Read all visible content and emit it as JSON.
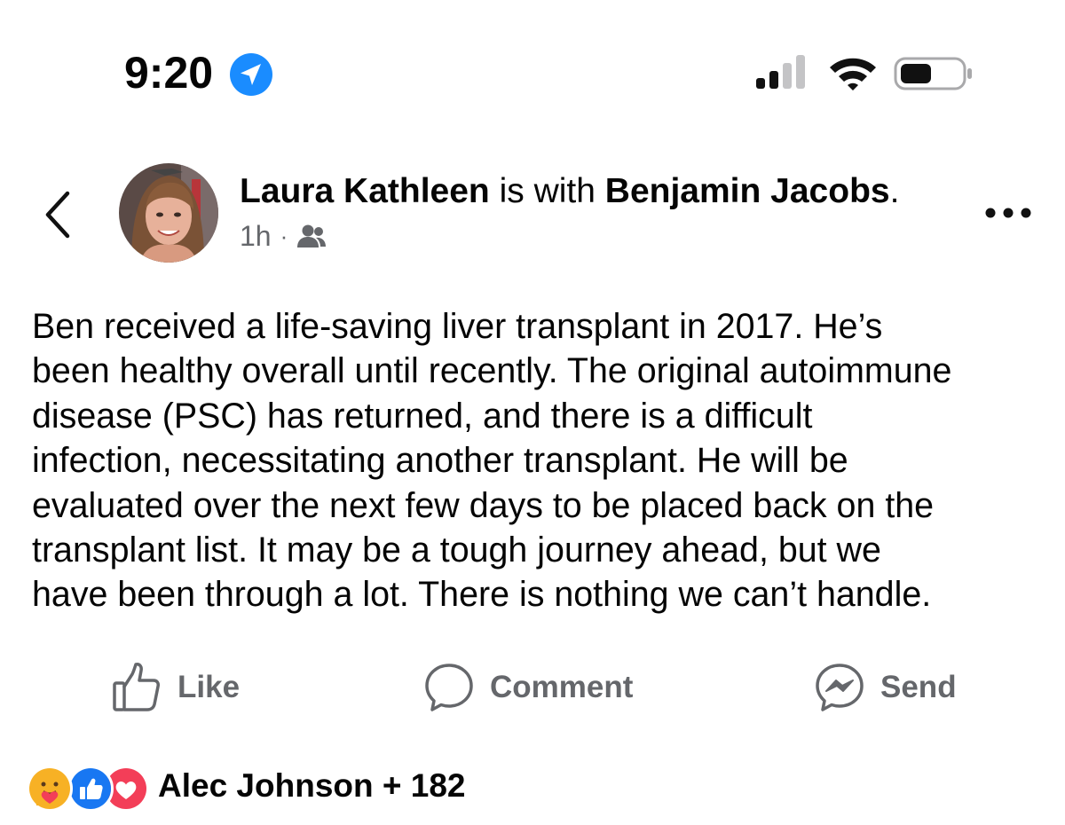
{
  "status_bar": {
    "time": "9:20",
    "icons": [
      "location-arrow-icon",
      "cellular-signal-icon",
      "wifi-icon",
      "battery-icon"
    ]
  },
  "post": {
    "author": "Laura Kathleen",
    "with_text": "is with",
    "tagged": "Benjamin Jacobs",
    "tagged_suffix": ".",
    "time_ago": "1h",
    "separator": "·",
    "audience_icon": "friends-icon",
    "body_lines": [
      "Ben received a life-saving liver transplant in 2017. He’s",
      "been healthy overall until recently. The original autoimmune",
      "disease (PSC) has returned, and there is a difficult",
      "infection, necessitating another transplant. He will be",
      "evaluated over the next few days to be placed back on the",
      "transplant list. It may be a tough journey ahead, but we",
      "have been through a lot. There is nothing we can’t handle."
    ]
  },
  "actions": {
    "like": "Like",
    "comment": "Comment",
    "send": "Send"
  },
  "reactions": {
    "icons": [
      "care-reaction-icon",
      "like-reaction-icon",
      "love-reaction-icon"
    ],
    "summary": "Alec Johnson + 182"
  },
  "colors": {
    "accent_blue": "#1877f2",
    "ios_blue": "#1a8cff",
    "muted_text": "#65676b",
    "love_red": "#f33e58",
    "care_yellow": "#f7b125"
  }
}
